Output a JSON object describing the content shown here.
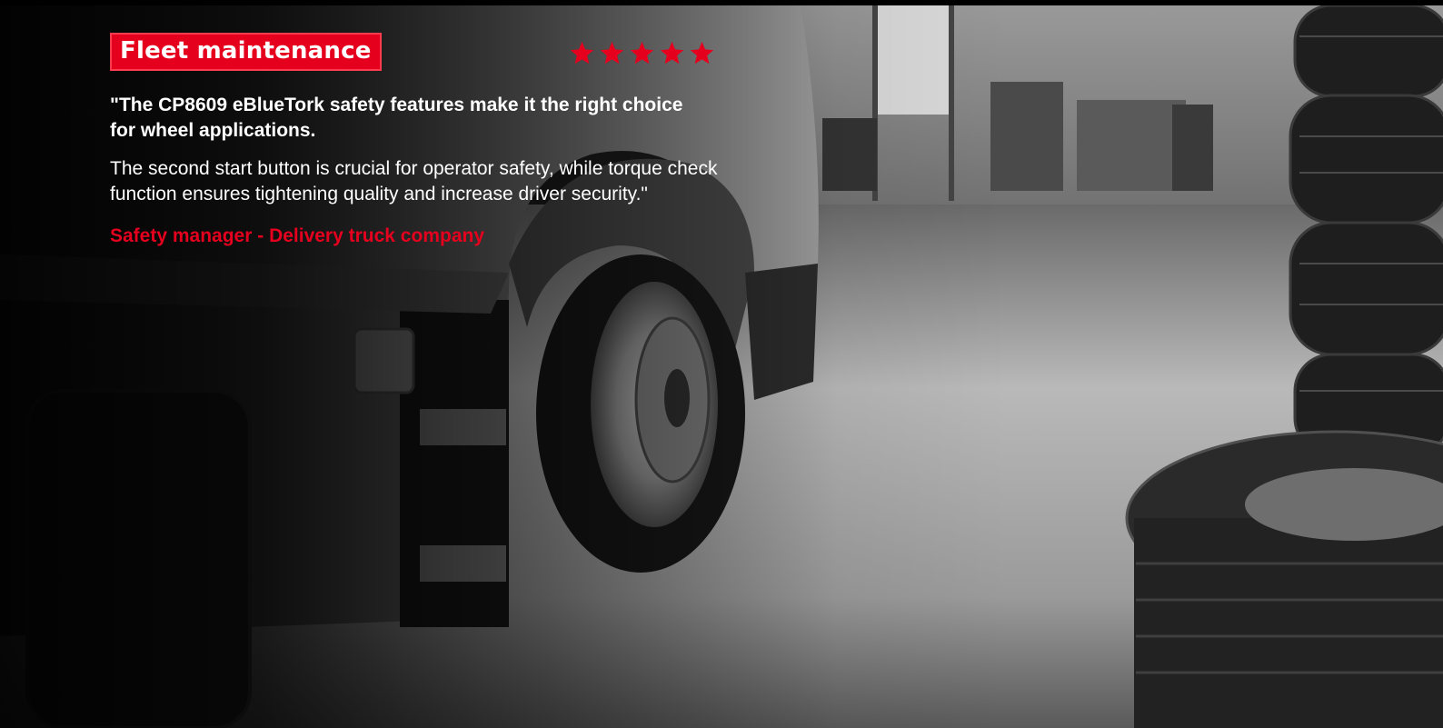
{
  "hero": {
    "badge": "Fleet maintenance",
    "rating": 5,
    "quote_headline": "\"The CP8609 eBlueTork safety features make it the right choice for wheel applications.",
    "quote_body": "The second start button is crucial for operator safety, while torque check function ensures tightening quality and increase driver security.\"",
    "author": "Safety manager - Delivery truck company"
  },
  "colors": {
    "accent": "#e5001e",
    "text": "#ffffff"
  },
  "icons": {
    "rating": "star-icon"
  }
}
